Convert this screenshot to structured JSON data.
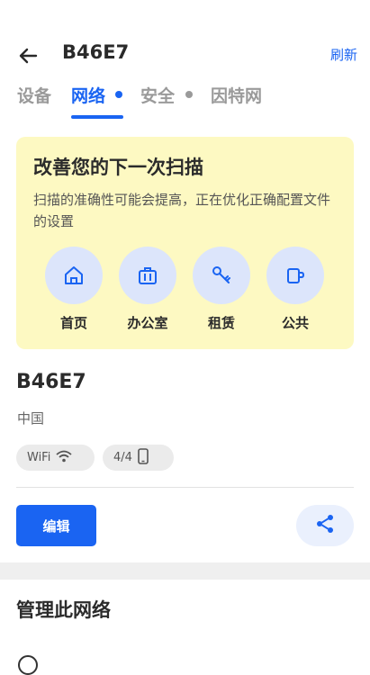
{
  "header": {
    "title": "B46E7",
    "refresh_label": "刷新",
    "back_icon": "arrow-left-icon"
  },
  "tabs": [
    {
      "label": "设备",
      "active": false,
      "dot": null
    },
    {
      "label": "网络",
      "active": true,
      "dot": "#1a64f2"
    },
    {
      "label": "安全",
      "active": false,
      "dot": "#9a9a9a"
    },
    {
      "label": "因特网",
      "active": false,
      "dot": null
    }
  ],
  "scan_card": {
    "title": "改善您的下一次扫描",
    "description": "扫描的准确性可能会提高，正在优化正确配置文件的设置",
    "options": [
      {
        "label": "首页",
        "icon": "home-icon"
      },
      {
        "label": "办公室",
        "icon": "briefcase-icon"
      },
      {
        "label": "租赁",
        "icon": "key-icon"
      },
      {
        "label": "公共",
        "icon": "coffee-cup-icon"
      }
    ]
  },
  "network": {
    "name": "B46E7",
    "country": "中国",
    "chips": [
      {
        "label": "WiFi",
        "icon": "wifi-icon"
      },
      {
        "label": "4/4",
        "icon": "phone-icon"
      }
    ]
  },
  "actions": {
    "edit_label": "编辑",
    "share_icon": "share-icon"
  },
  "manage": {
    "title": "管理此网络"
  },
  "colors": {
    "accent": "#1a64f2",
    "card_bg": "#fdf9c2",
    "icon_circle": "#dce5fb"
  }
}
